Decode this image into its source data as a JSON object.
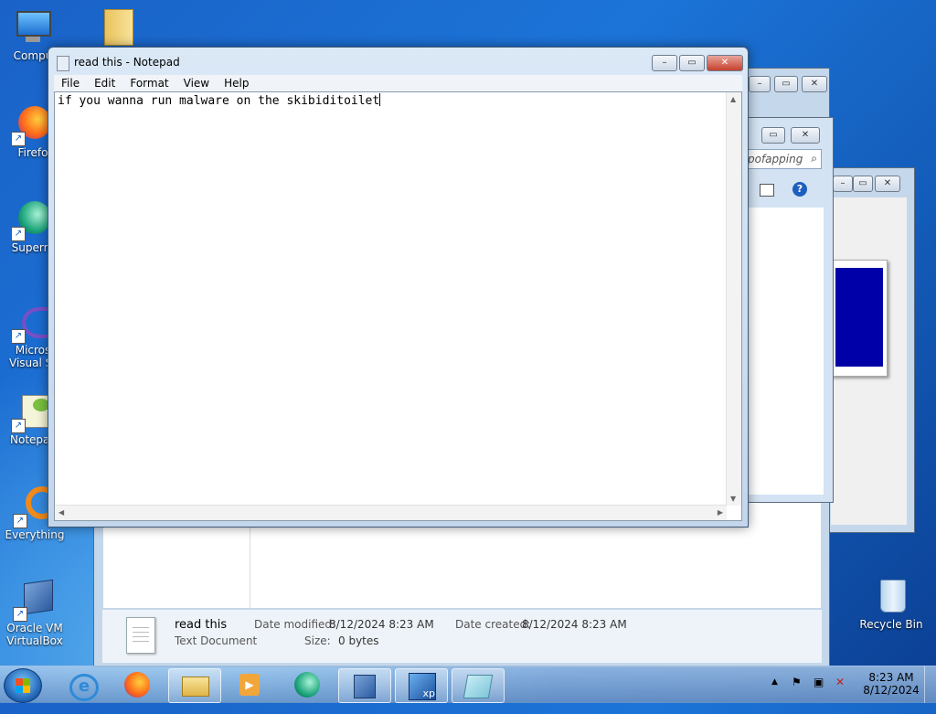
{
  "desktop": {
    "icons": [
      {
        "label": "Compu"
      },
      {
        "label": "Firefo"
      },
      {
        "label": "Superm"
      },
      {
        "label": "Micros\nVisual St"
      },
      {
        "label": "Notepac"
      },
      {
        "label": "Everything"
      },
      {
        "label": "Oracle VM\nVirtualBox"
      },
      {
        "label": "Recycle Bin"
      }
    ]
  },
  "explorer": {
    "search_placeholder": "pofapping",
    "details": {
      "name": "read this",
      "type": "Text Document",
      "date_modified_label": "Date modified:",
      "date_modified": "8/12/2024 8:23 AM",
      "date_created_label": "Date created:",
      "date_created": "8/12/2024 8:23 AM",
      "size_label": "Size:",
      "size": "0 bytes"
    }
  },
  "notepad": {
    "title": "read this - Notepad",
    "menu": [
      "File",
      "Edit",
      "Format",
      "View",
      "Help"
    ],
    "content": "if you wanna run malware on the skibiditoilet"
  },
  "taskbar": {
    "pinned": [
      "internet-explorer",
      "firefox",
      "file-explorer",
      "media-player",
      "supermium",
      "virtualbox",
      "windows-xp",
      "notepad"
    ],
    "clock": {
      "time": "8:23 AM",
      "date": "8/12/2024"
    }
  }
}
